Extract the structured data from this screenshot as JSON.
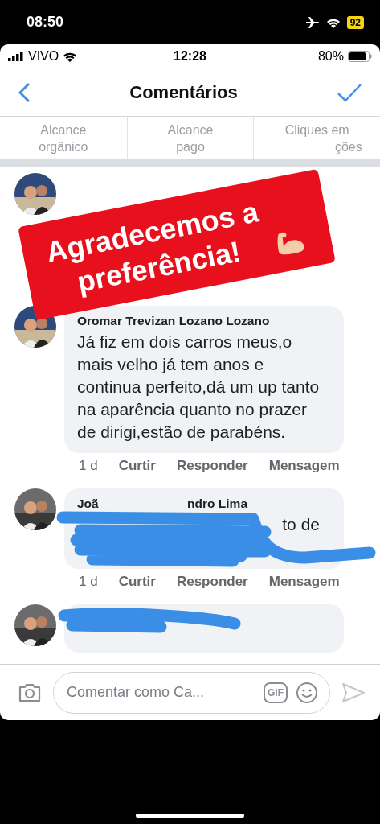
{
  "device_status": {
    "time": "08:50",
    "battery": "92"
  },
  "status_bar": {
    "carrier": "VIVO",
    "time": "12:28",
    "battery": "80%"
  },
  "nav": {
    "title": "Comentários"
  },
  "tabs": [
    {
      "label": "Alcance orgânico"
    },
    {
      "label": "Alcance pago"
    },
    {
      "label": "Cliques em",
      "fragment": "ções"
    }
  ],
  "sticker": {
    "lines": [
      "Agradecemos a",
      "preferência!"
    ]
  },
  "comments": [
    {
      "kind": "covered"
    },
    {
      "kind": "full",
      "author": "Oromar Trevizan Lozano Lozano",
      "text": "Já fiz em dois carros meus,o mais velho já tem anos e continua perfeito,dá um up tanto na aparência quanto no prazer de dirigi,estão de parabéns.",
      "actions": [
        "1 d",
        "Curtir",
        "Responder",
        "Mensagem"
      ]
    },
    {
      "kind": "scribbled",
      "author_fragments": [
        "Joã",
        "ndro Lima"
      ],
      "text_fragment": "to de",
      "actions": [
        "1 d",
        "Curtir",
        "Responder",
        "Mensagem"
      ]
    },
    {
      "kind": "cut"
    }
  ],
  "composer": {
    "placeholder": "Comentar como Ca...",
    "gif": "GIF"
  }
}
